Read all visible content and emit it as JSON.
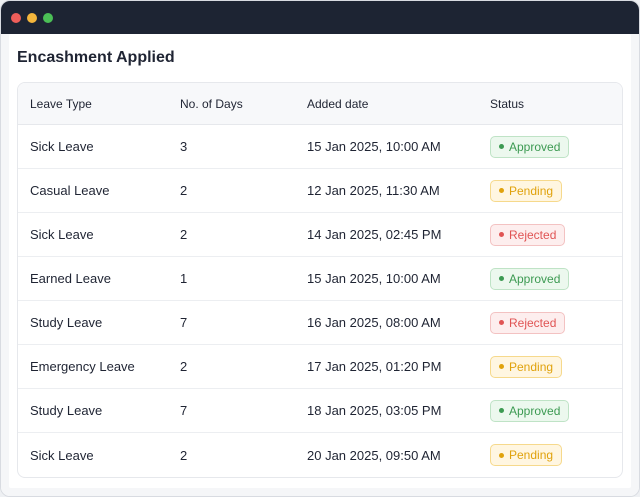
{
  "window": {
    "colors": {
      "close": "#ee5e5a",
      "minimize": "#f4b63c",
      "maximize": "#4bbf56"
    }
  },
  "page": {
    "title": "Encashment Applied"
  },
  "table": {
    "headers": [
      "Leave Type",
      "No. of Days",
      "Added date",
      "Status"
    ],
    "rows": [
      {
        "type": "Sick Leave",
        "days": "3",
        "date": "15 Jan 2025, 10:00 AM",
        "status": "Approved",
        "status_kind": "approved"
      },
      {
        "type": "Casual Leave",
        "days": "2",
        "date": "12 Jan 2025, 11:30 AM",
        "status": "Pending",
        "status_kind": "pending"
      },
      {
        "type": "Sick Leave",
        "days": "2",
        "date": "14 Jan 2025, 02:45 PM",
        "status": "Rejected",
        "status_kind": "rejected"
      },
      {
        "type": "Earned Leave",
        "days": "1",
        "date": "15 Jan 2025, 10:00 AM",
        "status": "Approved",
        "status_kind": "approved"
      },
      {
        "type": "Study Leave",
        "days": "7",
        "date": "16 Jan 2025, 08:00 AM",
        "status": "Rejected",
        "status_kind": "rejected"
      },
      {
        "type": "Emergency Leave",
        "days": "2",
        "date": "17 Jan 2025, 01:20 PM",
        "status": "Pending",
        "status_kind": "pending"
      },
      {
        "type": "Study Leave",
        "days": "7",
        "date": "18 Jan 2025, 03:05 PM",
        "status": "Approved",
        "status_kind": "approved"
      },
      {
        "type": "Sick Leave",
        "days": "2",
        "date": "20 Jan 2025, 09:50 AM",
        "status": "Pending",
        "status_kind": "pending"
      }
    ]
  }
}
